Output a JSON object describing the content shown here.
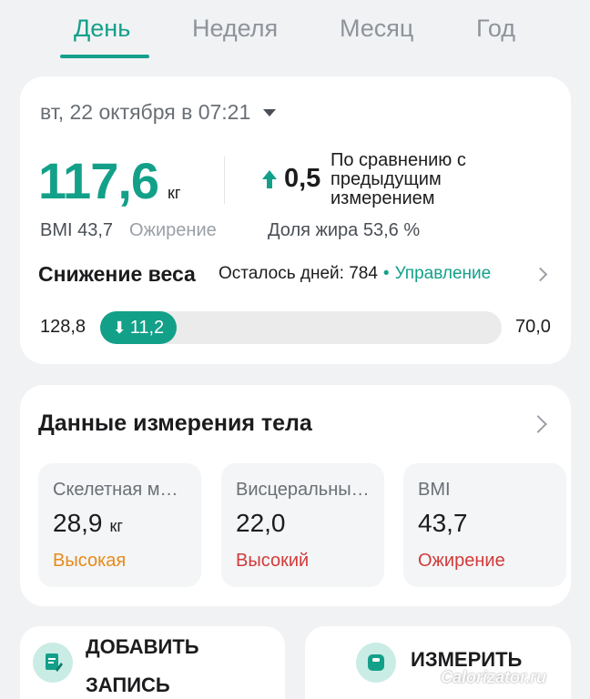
{
  "tabs": [
    {
      "label": "День",
      "active": true
    },
    {
      "label": "Неделя",
      "active": false
    },
    {
      "label": "Месяц",
      "active": false
    },
    {
      "label": "Год",
      "active": false
    }
  ],
  "summary": {
    "date": "вт, 22 октября в 07:21",
    "weight_value": "117,6",
    "weight_unit": "кг",
    "delta_value": "0,5",
    "delta_note": "По сравнению с предыдущим измерением",
    "bmi": "BMI 43,7",
    "bmi_status": "Ожирение",
    "body_fat": "Доля жира 53,6 %"
  },
  "goal": {
    "title": "Снижение веса",
    "days_left": "Осталось дней: 784",
    "separator": "•",
    "manage_label": "Управление",
    "start_weight": "128,8",
    "target_weight": "70,0",
    "progress_label": "11,2",
    "progress_fraction": 0.19
  },
  "body": {
    "title": "Данные измерения тела",
    "metrics": [
      {
        "label": "Скелетная мышечная масса",
        "value": "28,9",
        "unit": "кг",
        "status": "Высокая",
        "status_color": "#e88a1a"
      },
      {
        "label": "Висцеральный жир",
        "value": "22,0",
        "unit": "",
        "status": "Высокий",
        "status_color": "#d13b3b"
      },
      {
        "label": "BMI",
        "value": "43,7",
        "unit": "",
        "status": "Ожирение",
        "status_color": "#d13b3b"
      }
    ]
  },
  "actions": {
    "add_label": "ДОБАВИТЬ ЗАПИСЬ",
    "measure_label": "ИЗМЕРИТЬ"
  },
  "watermark": "Calorizator.ru",
  "colors": {
    "accent": "#13a089",
    "warning": "#e88a1a",
    "danger": "#d13b3b"
  }
}
